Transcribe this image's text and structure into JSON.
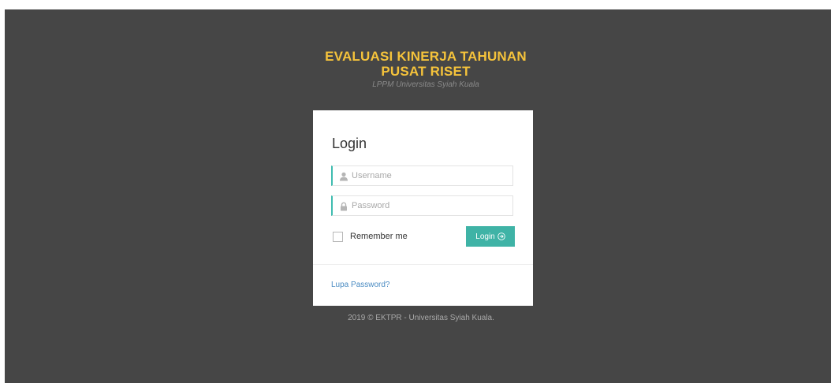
{
  "header": {
    "title_line1": "EVALUASI KINERJA TAHUNAN",
    "title_line2": "PUSAT RISET",
    "subtitle": "LPPM Universitas Syiah Kuala"
  },
  "login": {
    "title": "Login",
    "username_placeholder": "Username",
    "password_placeholder": "Password",
    "username_value": "",
    "password_value": "",
    "remember_label": "Remember me",
    "remember_checked": false,
    "submit_label": "Login",
    "forgot_link": "Lupa Password?"
  },
  "footer": {
    "text": "2019 © EKTPR - Universitas Syiah Kuala."
  },
  "icons": {
    "username": "user-icon",
    "password": "lock-icon",
    "submit": "circle-arrow-right-icon"
  },
  "colors": {
    "background": "#464646",
    "title": "#f5c33b",
    "accent": "#3fb3a6",
    "link": "#4a8bc2"
  }
}
